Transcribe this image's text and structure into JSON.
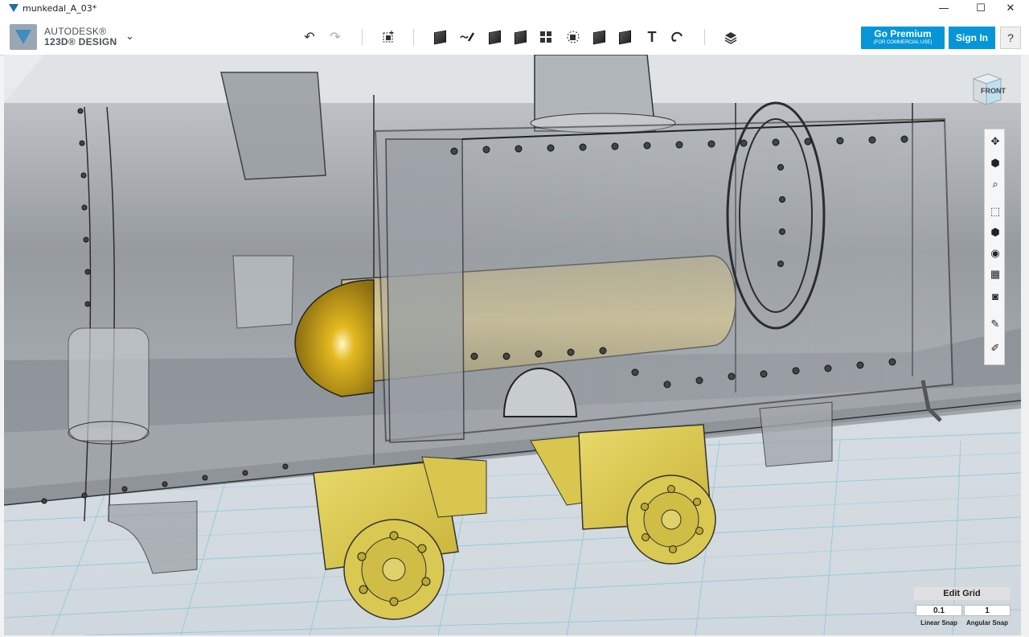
{
  "window": {
    "title": "munkedal_A_03*",
    "minimize": "—",
    "maximize": "☐",
    "close": "✕"
  },
  "app": {
    "brand_line1": "AUTODESK®",
    "brand_line2": "123D® DESIGN"
  },
  "toolbar": {
    "undo": "↶",
    "redo": "↷",
    "text_tool": "T",
    "go_premium_label": "Go Premium",
    "go_premium_sub": "(FOR COMMERCIAL USE)",
    "sign_in_label": "Sign In",
    "help_label": "?"
  },
  "viewcube": {
    "face_label": "FRONT"
  },
  "grid": {
    "edit_label": "Edit Grid",
    "linear_snap_value": "0.1",
    "linear_snap_label": "Linear Snap",
    "angular_snap_value": "1",
    "angular_snap_label": "Angular Snap"
  },
  "colors": {
    "accent": "#0696d7",
    "brass": "#d8c24a",
    "shell": "#8e9399"
  }
}
